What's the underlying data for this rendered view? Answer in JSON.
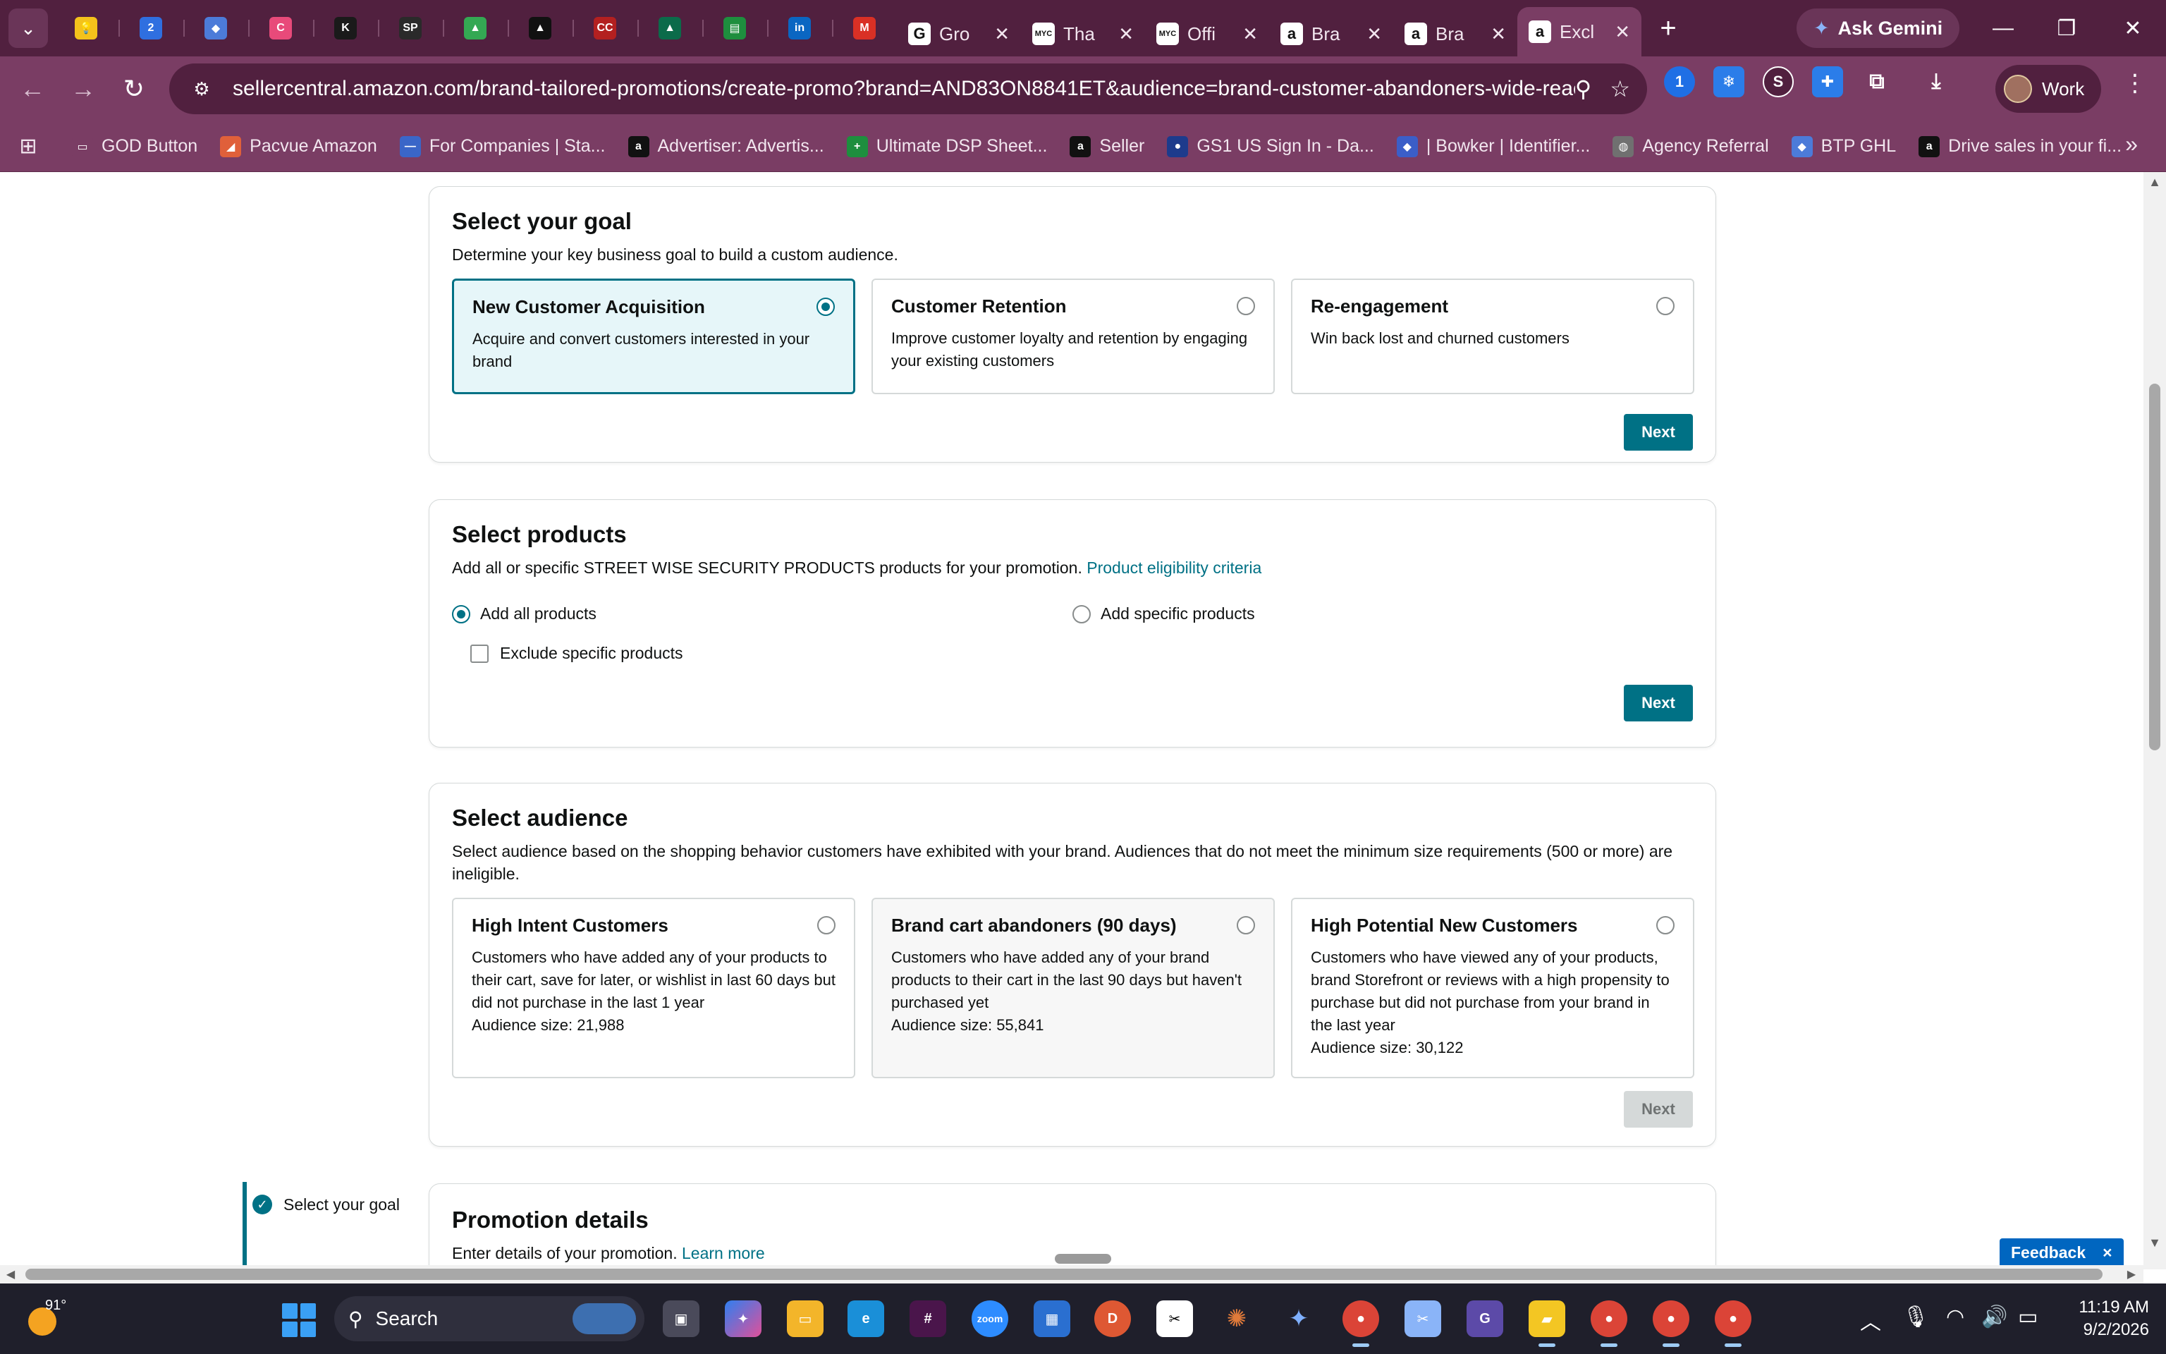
{
  "browser": {
    "tabs": {
      "pinned": [
        {
          "icon": "bulb-icon",
          "glyph": "💡",
          "color": "#f4c21b"
        },
        {
          "icon": "two-icon",
          "glyph": "2",
          "color": "#2f6fe0"
        },
        {
          "icon": "diamond-icon",
          "glyph": "◆",
          "color": "#4c7bd9"
        },
        {
          "icon": "clickup-icon",
          "glyph": "C",
          "color": "#e84a7a"
        },
        {
          "icon": "k-icon",
          "glyph": "K",
          "color": "#1a1a1a"
        },
        {
          "icon": "sp-icon",
          "glyph": "SP",
          "color": "#2a2a2a"
        },
        {
          "icon": "drive-icon",
          "glyph": "▲",
          "color": "#34a853"
        },
        {
          "icon": "triangle-icon",
          "glyph": "▲",
          "color": "#111111"
        },
        {
          "icon": "ccyou-icon",
          "glyph": "CC",
          "color": "#b32020"
        },
        {
          "icon": "peak-icon",
          "glyph": "▲",
          "color": "#0b6b4a"
        },
        {
          "icon": "sheets-icon",
          "glyph": "▤",
          "color": "#1e8e3e"
        },
        {
          "icon": "linkedin-icon",
          "glyph": "in",
          "color": "#0a66c2"
        },
        {
          "icon": "gmail-icon",
          "glyph": "M",
          "color": "#d93025"
        }
      ],
      "named": [
        {
          "label": "Gro",
          "icon": "grammarly-icon",
          "glyph": "G",
          "color": "#15c39a",
          "active": false
        },
        {
          "label": "Tha",
          "icon": "myc-icon",
          "glyph": "MYC",
          "color": "#ffffff",
          "active": false
        },
        {
          "label": "Offi",
          "icon": "myc-icon",
          "glyph": "MYC",
          "color": "#ffffff",
          "active": false
        },
        {
          "label": "Bra",
          "icon": "amazon-icon",
          "glyph": "a",
          "color": "#111111",
          "active": false
        },
        {
          "label": "Bra",
          "icon": "amazon-icon",
          "glyph": "a",
          "color": "#111111",
          "active": false
        },
        {
          "label": "Excl",
          "icon": "amazon-icon",
          "glyph": "a",
          "color": "#111111",
          "active": true
        }
      ],
      "gemini_label": "Ask Gemini"
    },
    "url": "sellercentral.amazon.com/brand-tailored-promotions/create-promo?brand=AND83ON8841ET&audience=brand-customer-abandoners-wide-reach&...",
    "profile_label": "Work",
    "bookmarks": [
      {
        "label": "GOD Button",
        "icon": "folder-icon",
        "glyph": "▭",
        "color": "#7a3d64"
      },
      {
        "label": "Pacvue Amazon",
        "icon": "pacvue-icon",
        "glyph": "◢",
        "color": "#e0603a"
      },
      {
        "label": "For Companies | Sta...",
        "icon": "sta-icon",
        "glyph": "—",
        "color": "#3a66c8"
      },
      {
        "label": "Advertiser: Advertis...",
        "icon": "amazon-ads-icon",
        "glyph": "a",
        "color": "#111111"
      },
      {
        "label": "Ultimate DSP Sheet...",
        "icon": "sheets-plus-icon",
        "glyph": "+",
        "color": "#1e8e3e"
      },
      {
        "label": "Seller",
        "icon": "amazon-icon",
        "glyph": "a",
        "color": "#111111"
      },
      {
        "label": "GS1 US Sign In - Da...",
        "icon": "gs1-icon",
        "glyph": "●",
        "color": "#1d3b8c"
      },
      {
        "label": "| Bowker | Identifier...",
        "icon": "bowker-icon",
        "glyph": "◆",
        "color": "#3b5ec8"
      },
      {
        "label": "Agency Referral",
        "icon": "globe-icon",
        "glyph": "◍",
        "color": "#707070"
      },
      {
        "label": "BTP GHL",
        "icon": "btp-icon",
        "glyph": "◆",
        "color": "#4c7bd9"
      },
      {
        "label": "Drive sales in your fi...",
        "icon": "amazon-icon",
        "glyph": "a",
        "color": "#111111"
      }
    ]
  },
  "goal": {
    "title": "Select your goal",
    "description": "Determine your key business goal to build a custom audience.",
    "options": [
      {
        "title": "New Customer Acquisition",
        "body": "Acquire and convert customers interested in your brand",
        "selected": true
      },
      {
        "title": "Customer Retention",
        "body": "Improve customer loyalty and retention by engaging your existing customers",
        "selected": false
      },
      {
        "title": "Re-engagement",
        "body": "Win back lost and churned customers",
        "selected": false
      }
    ],
    "next_label": "Next"
  },
  "products": {
    "title": "Select products",
    "description": "Add all or specific STREET WISE SECURITY PRODUCTS products for your promotion.",
    "eligibility_link": "Product eligibility criteria",
    "add_all_label": "Add all products",
    "add_specific_label": "Add specific products",
    "exclude_label": "Exclude specific products",
    "next_label": "Next"
  },
  "audience": {
    "title": "Select audience",
    "description": "Select audience based on the shopping behavior customers have exhibited with your brand. Audiences that do not meet the minimum size requirements (500 or more) are ineligible.",
    "options": [
      {
        "title": "High Intent Customers",
        "body": "Customers who have added any of your products to their cart, save for later, or wishlist in last 60 days but did not purchase in the last 1 year",
        "size": "Audience size: 21,988",
        "selected": false
      },
      {
        "title": "Brand cart abandoners (90 days)",
        "body": "Customers who have added any of your brand products to their cart in the last 90 days but haven't purchased yet",
        "size": "Audience size: 55,841",
        "selected": false
      },
      {
        "title": "High Potential New Customers",
        "body": "Customers who have viewed any of your products, brand Storefront or reviews with a high propensity to purchase but did not purchase from your brand in the last year",
        "size": "Audience size: 30,122",
        "selected": false
      }
    ],
    "next_label": "Next"
  },
  "promotion": {
    "title": "Promotion details",
    "description": "Enter details of your promotion.",
    "learn_more": "Learn more"
  },
  "stepper": {
    "step1": "Select your goal"
  },
  "feedback": {
    "label": "Feedback",
    "close": "×"
  },
  "taskbar": {
    "temperature": "91°",
    "search_label": "Search",
    "time": "11:19 AM",
    "date": "9/2/2026"
  },
  "colors": {
    "chrome_dark": "#51203f",
    "chrome_mid": "#7a3d64",
    "accent_teal": "#007185",
    "feedback_blue": "#0066c0"
  }
}
